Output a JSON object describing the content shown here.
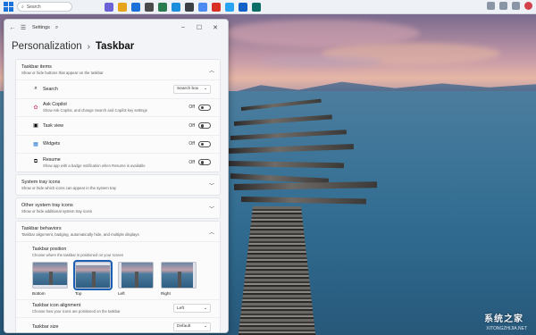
{
  "taskbar": {
    "search_placeholder": "Search",
    "app_colors": [
      "#6c63d7",
      "#e7a31b",
      "#1b6fd8",
      "#4b4b4b",
      "#2a7b4f",
      "#1c8edb",
      "#3a3f46",
      "#4b8af0",
      "#d93025",
      "#2aa3f2",
      "#1560c7",
      "#0a6e66"
    ]
  },
  "window": {
    "app_title": "Settings",
    "breadcrumb": {
      "parent": "Personalization",
      "separator": "›",
      "current": "Taskbar"
    }
  },
  "sections": {
    "taskbar_items": {
      "title": "Taskbar items",
      "subtitle": "Show or hide buttons that appear on the taskbar",
      "rows": [
        {
          "icon": "search-icon",
          "label": "Search",
          "sub": "",
          "control": "dropdown",
          "value": "Search box"
        },
        {
          "icon": "copilot-icon",
          "label": "Ask Copilot",
          "sub": "Show Ask Copilot, and change Search and Copilot key settings",
          "control": "toggle",
          "value": "Off"
        },
        {
          "icon": "task-view-icon",
          "label": "Task view",
          "sub": "",
          "control": "toggle",
          "value": "Off"
        },
        {
          "icon": "widgets-icon",
          "label": "Widgets",
          "sub": "",
          "control": "toggle",
          "value": "Off"
        },
        {
          "icon": "resume-icon",
          "label": "Resume",
          "sub": "Show app with a badge notification when Resume is available",
          "control": "toggle",
          "value": "Off"
        }
      ]
    },
    "system_tray": {
      "title": "System tray icons",
      "subtitle": "Show or hide which icons can appear in the system tray"
    },
    "other_tray": {
      "title": "Other system tray icons",
      "subtitle": "Show or hide additional system tray icons"
    },
    "behaviors": {
      "title": "Taskbar behaviors",
      "subtitle": "Taskbar alignment, badging, automatically hide, and multiple displays",
      "position": {
        "label": "Taskbar position",
        "sub": "Choose where the taskbar is positioned on your screen",
        "options": [
          "Bottom",
          "Top",
          "Left",
          "Right"
        ],
        "selected": "Top"
      },
      "alignment": {
        "label": "Taskbar icon alignment",
        "sub": "Choose how your icons are positioned on the taskbar",
        "value": "Left"
      },
      "size": {
        "label": "Taskbar size",
        "value": "Default"
      }
    }
  },
  "watermark": {
    "line1": "系统之家",
    "line2": "XITONGZHIJIA.NET"
  }
}
